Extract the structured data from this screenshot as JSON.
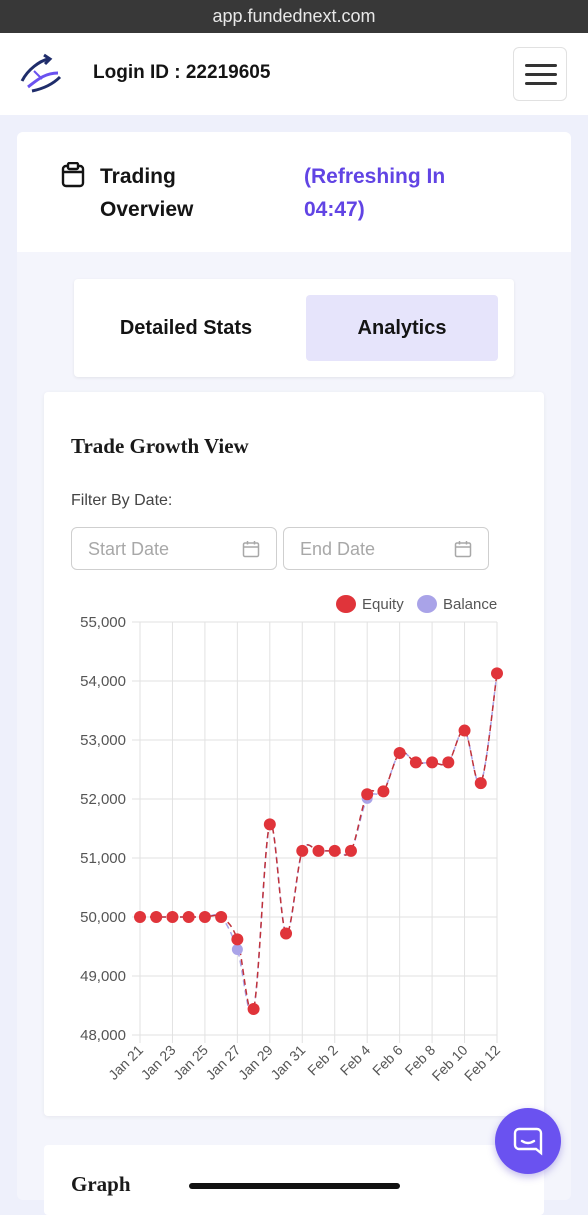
{
  "browser": {
    "url": "app.fundednext.com"
  },
  "header": {
    "login_text": "Login ID : 22219605"
  },
  "overview": {
    "title": "Trading Overview",
    "refresh_text": "(Refreshing In 04:47)"
  },
  "tabs": [
    {
      "label": "Detailed Stats",
      "active": false
    },
    {
      "label": "Analytics",
      "active": true
    }
  ],
  "trade_growth": {
    "title": "Trade Growth View",
    "filter_label": "Filter By Date:",
    "start_placeholder": "Start Date",
    "end_placeholder": "End Date"
  },
  "chart_data": {
    "type": "line",
    "categories": [
      "Jan 21",
      "Jan 22",
      "Jan 23",
      "Jan 24",
      "Jan 25",
      "Jan 26",
      "Jan 27",
      "Jan 28",
      "Jan 29",
      "Jan 30",
      "Jan 31",
      "Feb 1",
      "Feb 2",
      "Feb 3",
      "Feb 4",
      "Feb 5",
      "Feb 6",
      "Feb 7",
      "Feb 8",
      "Feb 9",
      "Feb 10",
      "Feb 11",
      "Feb 12"
    ],
    "tick_labels": [
      "Jan 21",
      "Jan 23",
      "Jan 25",
      "Jan 27",
      "Jan 29",
      "Jan 31",
      "Feb 2",
      "Feb 4",
      "Feb 6",
      "Feb 8",
      "Feb 10",
      "Feb 12"
    ],
    "series": [
      {
        "name": "Equity",
        "color": "#e0343a",
        "values": [
          50000,
          50000,
          50000,
          50000,
          50000,
          50000,
          49620,
          48440,
          51570,
          49720,
          51120,
          51120,
          51120,
          51120,
          52080,
          52130,
          52780,
          52620,
          52620,
          52620,
          53160,
          52270,
          54130
        ]
      },
      {
        "name": "Balance",
        "color": "#a9a3e8",
        "values": [
          50000,
          50000,
          50000,
          50000,
          50000,
          50000,
          49450,
          48440,
          51570,
          49720,
          51120,
          51120,
          51120,
          51120,
          52010,
          52130,
          52780,
          52620,
          52620,
          52620,
          53160,
          52270,
          54130
        ]
      }
    ],
    "y_ticks": [
      "48,000",
      "49,000",
      "50,000",
      "51,000",
      "52,000",
      "53,000",
      "54,000",
      "55,000"
    ],
    "ylim": [
      48000,
      55000
    ],
    "grid": true,
    "legend": "top-right"
  },
  "graph_section": {
    "title": "Graph"
  },
  "icons": {
    "menu": "hamburger-icon",
    "overview": "clipboard-icon",
    "calendar": "calendar-icon",
    "chat": "chat-bubble-icon"
  }
}
